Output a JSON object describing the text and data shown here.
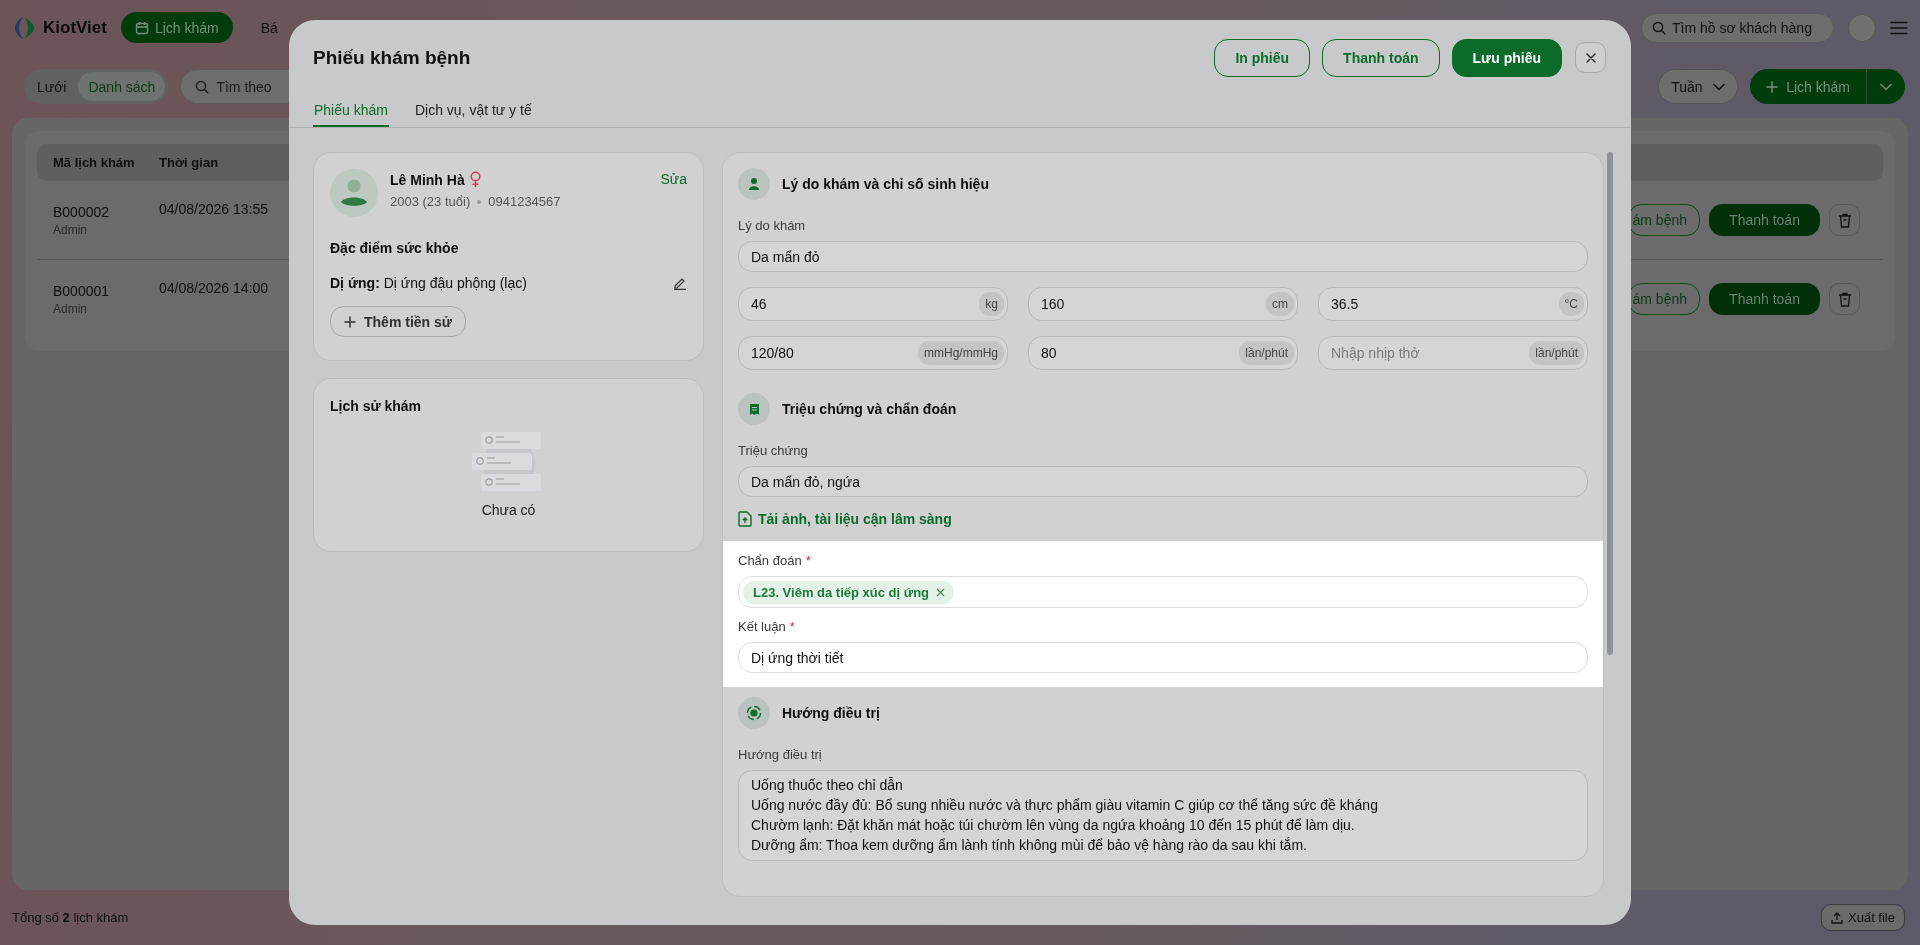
{
  "app": {
    "logo": "KiotViet",
    "nav": [
      {
        "label": "Lịch khám",
        "selected": true
      },
      {
        "label": "Bá",
        "selected": false
      }
    ],
    "customer_search": {
      "placeholder": "Tìm hồ sơ khách hàng"
    }
  },
  "toolbar": {
    "views": [
      {
        "label": "Lưới",
        "selected": false
      },
      {
        "label": "Danh sách",
        "selected": true
      }
    ],
    "search": {
      "placeholder": "Tìm theo"
    },
    "period": "Tuần",
    "add_button": "Lịch khám"
  },
  "table": {
    "columns": [
      "Mã lịch khám",
      "Thời gian"
    ],
    "rows": [
      {
        "code": "B000002",
        "user": "Admin",
        "time": "04/08/2026 13:55",
        "actions": [
          "ám bệnh",
          "Thanh toán"
        ]
      },
      {
        "code": "B000001",
        "user": "Admin",
        "time": "04/08/2026 14:00",
        "actions": [
          "ám bệnh",
          "Thanh toán"
        ]
      }
    ]
  },
  "footer": {
    "total": "Tổng số **2** lịch khám",
    "export": "Xuất file"
  },
  "modal": {
    "title": "Phiếu khám bệnh",
    "actions": [
      {
        "label": "In phiếu",
        "kind": "outline"
      },
      {
        "label": "Thanh toán",
        "kind": "outline"
      },
      {
        "label": "Lưu phiếu",
        "kind": "primary"
      }
    ],
    "tabs": [
      {
        "label": "Phiếu khám",
        "selected": true
      },
      {
        "label": "Dịch vụ, vật tư y tế",
        "selected": false
      }
    ],
    "patient": {
      "name": "Lê Minh Hà",
      "birth": "2003 (23 tuổi)",
      "phone": "0941234567",
      "edit": "Sửa",
      "health_title": "Đặc điểm sức khỏe",
      "allergy": "**Dị ứng:** Dị ứng đậu phộng (lạc)",
      "add_history": "Thêm tiền sử"
    },
    "history": {
      "title": "Lịch sử khám",
      "empty": "Chưa có"
    },
    "vitals_section": {
      "title": "Lý do khám và chỉ số sinh hiệu",
      "reason": {
        "label": "Lý do khám",
        "value": "Da mẩn đỏ"
      },
      "vitals": [
        {
          "value": "46",
          "unit": "kg"
        },
        {
          "value": "160",
          "unit": "cm"
        },
        {
          "value": "36.5",
          "unit": "°C"
        },
        {
          "value": "120/80",
          "unit": "mmHg/mmHg"
        },
        {
          "value": "80",
          "unit": "lần/phút"
        },
        {
          "placeholder": "Nhập nhịp thở",
          "unit": "lần/phút"
        }
      ]
    },
    "diagnosis_section": {
      "title": "Triệu chứng và chẩn đoán",
      "symptoms": {
        "label": "Triệu chứng",
        "value": "Da mẩn đỏ, ngứa"
      },
      "upload_link": "Tải ảnh, tài liệu cận lâm sàng",
      "highlighted": true,
      "diagnosis": {
        "label": "Chẩn đoán",
        "required_mark": "*",
        "tags": [
          "L23. Viêm da tiếp xúc dị ứng"
        ]
      },
      "conclusion": {
        "label": "Kết luận",
        "required_mark": "*",
        "value": "Dị ứng thời tiết"
      }
    },
    "treatment_section": {
      "title": "Hướng điều trị",
      "label": "Hướng điều trị",
      "lines": [
        "Uống thuốc theo chỉ dẫn",
        "Uống nước đầy đủ: Bổ sung nhiều nước và thực phẩm giàu vitamin C giúp cơ thể tăng sức đề kháng",
        "Chườm lạnh: Đặt khăn mát hoặc túi chườm lên vùng da ngứa khoảng 10 đến 15 phút để làm dịu.",
        "Dưỡng ẩm: Thoa kem dưỡng ẩm lành tính không mùi để bảo vệ hàng rào da sau khi tắm."
      ]
    }
  }
}
